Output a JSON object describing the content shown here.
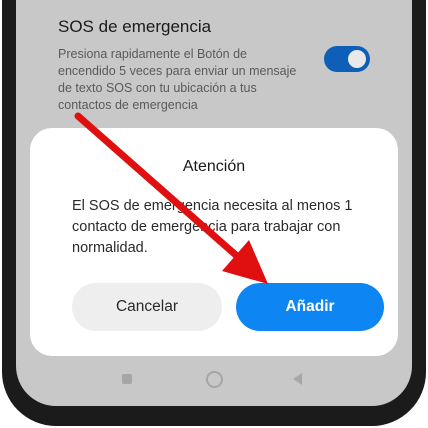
{
  "setting": {
    "title": "SOS de emergencia",
    "description": "Presiona rapidamente el Botón de encendido 5 veces para enviar un mensaje de texto SOS con tu ubicación a tus contactos de emergencia",
    "toggle_state": "on"
  },
  "dialog": {
    "title": "Atención",
    "message": "El SOS de emergencia necesita al menos 1 contacto de emergencia para trabajar con normalidad.",
    "cancel_label": "Cancelar",
    "add_label": "Añadir"
  },
  "colors": {
    "accent": "#0d85f2",
    "toggle": "#0e5fb8",
    "annotation_arrow": "#e01010"
  },
  "navbar": {
    "icons": [
      "recent-apps-icon",
      "home-icon",
      "back-icon"
    ]
  }
}
